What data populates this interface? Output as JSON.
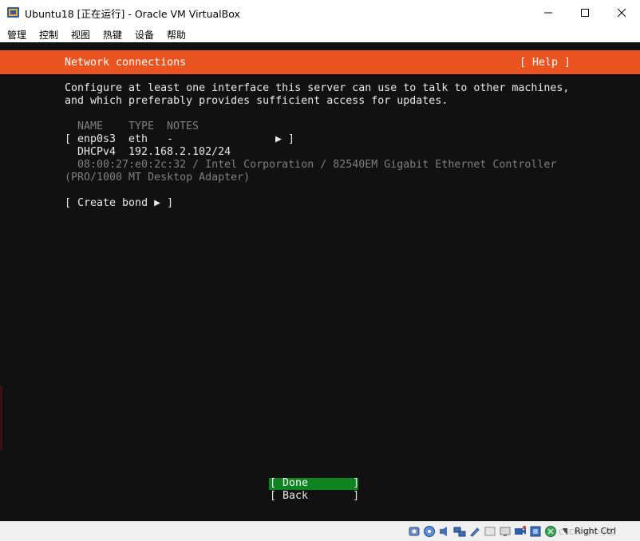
{
  "window": {
    "title": "Ubuntu18 [正在运行] - Oracle VM VirtualBox",
    "controls": [
      "minimize-icon",
      "maximize-icon",
      "close-icon"
    ]
  },
  "menu": {
    "items": [
      "管理",
      "控制",
      "视图",
      "热键",
      "设备",
      "帮助"
    ]
  },
  "installer": {
    "header_title": "Network connections",
    "help_label": "[ Help ]",
    "intro_line1": "Configure at least one interface this server can use to talk to other machines,",
    "intro_line2": "and which preferably provides sufficient access for updates.",
    "columns": {
      "name": "NAME",
      "type": "TYPE",
      "notes": "NOTES"
    },
    "interface": {
      "open_bracket": "[",
      "name": "enp0s3",
      "type": "eth",
      "notes": "-",
      "arrow": "▶ ]",
      "dhcp_label": "DHCPv4",
      "dhcp_address": "192.168.2.102/24",
      "hardware_line1": "08:00:27:e0:2c:32 / Intel Corporation / 82540EM Gigabit Ethernet Controller",
      "hardware_line2": "(PRO/1000 MT Desktop Adapter)"
    },
    "create_bond_label": "[ Create bond ▶ ]",
    "done_label": "[ Done       ]",
    "back_label": "[ Back       ]",
    "colors": {
      "accent": "#e95420",
      "selected": "#0e8420",
      "background": "#111111"
    }
  },
  "statusbar": {
    "icons": [
      "hard-disk-icon",
      "optical-drive-icon",
      "audio-icon",
      "network-icon",
      "usb-icon",
      "shared-folder-icon",
      "display-icon",
      "video-capture-icon",
      "virtualization-icon",
      "mouse-integration-icon",
      "keyboard-icon"
    ],
    "host_key": "Right Ctrl",
    "watermark": "CSDN @小小哲"
  }
}
